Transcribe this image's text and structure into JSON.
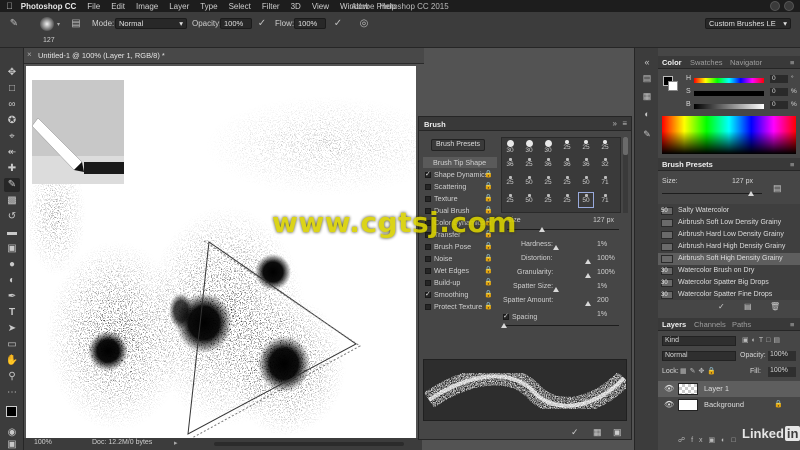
{
  "menubar": {
    "app_name": "Photoshop CC",
    "items": [
      "File",
      "Edit",
      "Image",
      "Layer",
      "Type",
      "Select",
      "Filter",
      "3D",
      "View",
      "Window",
      "Help"
    ],
    "window_title": "Adobe Photoshop CC 2015"
  },
  "options": {
    "brush_size": "127",
    "mode_label": "Mode:",
    "mode_value": "Normal",
    "opacity_label": "Opacity:",
    "opacity_value": "100%",
    "flow_label": "Flow:",
    "flow_value": "100%",
    "workspace": "Custom Brushes LE"
  },
  "document": {
    "tab_title": "Untitled-1 @ 100% (Layer 1, RGB/8) *",
    "zoom": "100%",
    "doc_info": "Doc: 12.2M/0 bytes"
  },
  "brush_panel": {
    "title": "Brush",
    "presets_button": "Brush Presets",
    "settings": [
      {
        "label": "Brush Tip Shape",
        "checkbox": false,
        "selected": true
      },
      {
        "label": "Shape Dynamics",
        "checkbox": true,
        "checked": true
      },
      {
        "label": "Scattering",
        "checkbox": true,
        "checked": false
      },
      {
        "label": "Texture",
        "checkbox": true,
        "checked": false
      },
      {
        "label": "Dual Brush",
        "checkbox": true,
        "checked": false
      },
      {
        "label": "Color Dynamics",
        "checkbox": true,
        "checked": false
      },
      {
        "label": "Transfer",
        "checkbox": true,
        "checked": false
      },
      {
        "label": "Brush Pose",
        "checkbox": true,
        "checked": false
      },
      {
        "label": "Noise",
        "checkbox": true,
        "checked": false
      },
      {
        "label": "Wet Edges",
        "checkbox": true,
        "checked": false
      },
      {
        "label": "Build-up",
        "checkbox": true,
        "checked": false
      },
      {
        "label": "Smoothing",
        "checkbox": true,
        "checked": true
      },
      {
        "label": "Protect Texture",
        "checkbox": true,
        "checked": false
      }
    ],
    "tip_sizes": [
      "30",
      "30",
      "30",
      "25",
      "25",
      "25",
      "36",
      "25",
      "36",
      "36",
      "36",
      "32",
      "25",
      "50",
      "25",
      "25",
      "50",
      "71",
      "25",
      "50",
      "25",
      "25",
      "50",
      "71"
    ],
    "size_value": "127 px",
    "hardness_label": "Hardness:",
    "hardness_value": "1%",
    "distortion_label": "Distortion:",
    "distortion_value": "100%",
    "granularity_label": "Granularity:",
    "granularity_value": "100%",
    "spatter_size_label": "Spatter Size:",
    "spatter_size_value": "1%",
    "spatter_amount_label": "Spatter Amount:",
    "spatter_amount_value": "200",
    "spacing_label": "Spacing",
    "spacing_value": "1%"
  },
  "color_panel": {
    "tabs": [
      "Color",
      "Swatches",
      "Navigator"
    ],
    "rows": [
      {
        "label": "H",
        "value": "0",
        "unit": "°"
      },
      {
        "label": "S",
        "value": "0",
        "unit": "%"
      },
      {
        "label": "B",
        "value": "0",
        "unit": "%"
      }
    ]
  },
  "brush_presets": {
    "title": "Brush Presets",
    "size_label": "Size:",
    "size_value": "127 px",
    "items": [
      {
        "num": "50",
        "name": "Salty Watercolor"
      },
      {
        "num": "",
        "name": "Airbrush Soft Low Density Grainy"
      },
      {
        "num": "",
        "name": "Airbrush Hard Low Density Grainy"
      },
      {
        "num": "",
        "name": "Airbrush Hard High Density Grainy"
      },
      {
        "num": "",
        "name": "Airbrush Soft High Density Grainy"
      },
      {
        "num": "30",
        "name": "Watercolor Brush on Dry"
      },
      {
        "num": "30",
        "name": "Watercolor Spatter Big Drops"
      },
      {
        "num": "30",
        "name": "Watercolor Spatter Fine Drops"
      }
    ]
  },
  "layers_panel": {
    "tabs": [
      "Layers",
      "Channels",
      "Paths"
    ],
    "filter_kind": "Kind",
    "blend_mode": "Normal",
    "opacity_label": "Opacity:",
    "opacity_value": "100%",
    "lock_label": "Lock:",
    "fill_label": "Fill:",
    "fill_value": "100%",
    "layers": [
      {
        "name": "Layer 1"
      },
      {
        "name": "Background"
      }
    ]
  },
  "watermark": "www.cgtsj.com",
  "linkedin": "Linked"
}
